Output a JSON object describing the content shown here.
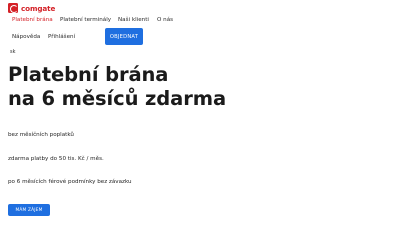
{
  "brand": {
    "logo_icon": "comgate-logo-icon",
    "name": "comgate",
    "color": "#d42127"
  },
  "nav": {
    "items": [
      {
        "label": "Platební brána",
        "active": true
      },
      {
        "label": "Platební terminály",
        "active": false
      },
      {
        "label": "Naši klienti",
        "active": false
      },
      {
        "label": "O nás",
        "active": false
      },
      {
        "label": "Nápověda",
        "active": false
      },
      {
        "label": "Přihlášení",
        "active": false
      }
    ],
    "order_button": "OBJEDNAT",
    "language": "sk"
  },
  "hero": {
    "title_line1": "Platební brána",
    "title_line2": "na 6 měsíců zdarma",
    "benefits": [
      "bez měsíčních poplatků",
      "zdarma platby do 50 tis. Kč / měs.",
      "po 6 měsících férové podmínky bez závazku"
    ],
    "cta_label": "MÁM ZÁJEM"
  },
  "colors": {
    "accent": "#1f6fe0",
    "active_link": "#d42127"
  }
}
